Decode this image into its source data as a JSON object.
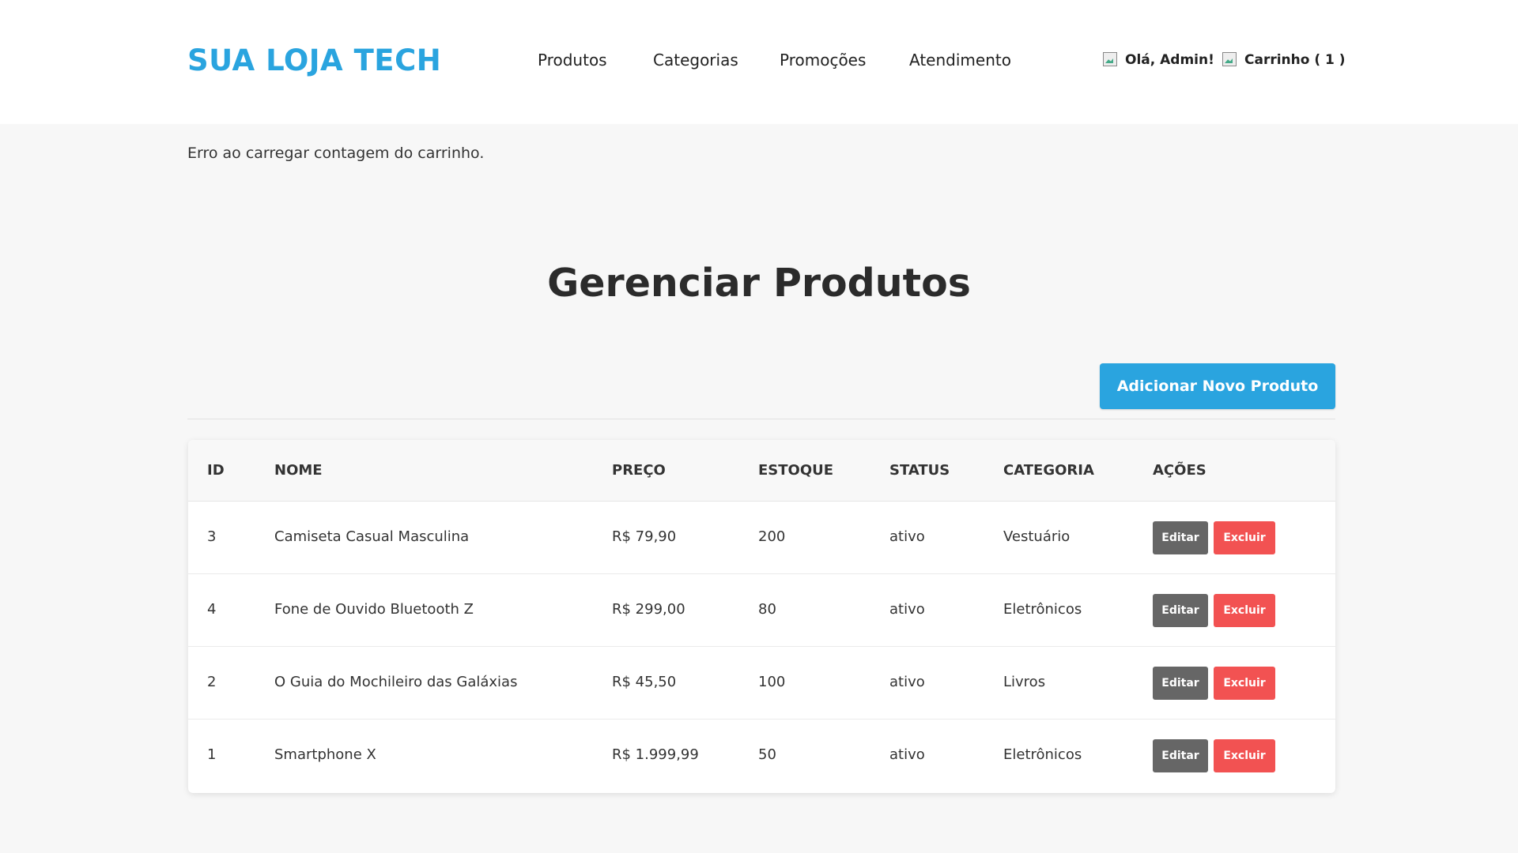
{
  "header": {
    "logo": "SUA LOJA TECH",
    "nav": [
      "Produtos",
      "Categorias",
      "Promoções",
      "Atendimento"
    ],
    "user_greeting": "Olá, Admin!",
    "cart_label": "Carrinho ( 1 )"
  },
  "error_message": "Erro ao carregar contagem do carrinho.",
  "page_title": "Gerenciar Produtos",
  "add_button_label": "Adicionar Novo Produto",
  "table": {
    "columns": [
      "ID",
      "NOME",
      "PREÇO",
      "ESTOQUE",
      "STATUS",
      "CATEGORIA",
      "AÇÕES"
    ],
    "rows": [
      {
        "id": "3",
        "nome": "Camiseta Casual Masculina",
        "preco": "R$ 79,90",
        "estoque": "200",
        "status": "ativo",
        "categoria": "Vestuário"
      },
      {
        "id": "4",
        "nome": "Fone de Ouvido Bluetooth Z",
        "preco": "R$ 299,00",
        "estoque": "80",
        "status": "ativo",
        "categoria": "Eletrônicos"
      },
      {
        "id": "2",
        "nome": "O Guia do Mochileiro das Galáxias",
        "preco": "R$ 45,50",
        "estoque": "100",
        "status": "ativo",
        "categoria": "Livros"
      },
      {
        "id": "1",
        "nome": "Smartphone X",
        "preco": "R$ 1.999,99",
        "estoque": "50",
        "status": "ativo",
        "categoria": "Eletrônicos"
      }
    ],
    "edit_label": "Editar",
    "delete_label": "Excluir"
  },
  "colors": {
    "accent": "#2aa4df",
    "danger": "#f25252",
    "neutral_button": "#666666"
  }
}
